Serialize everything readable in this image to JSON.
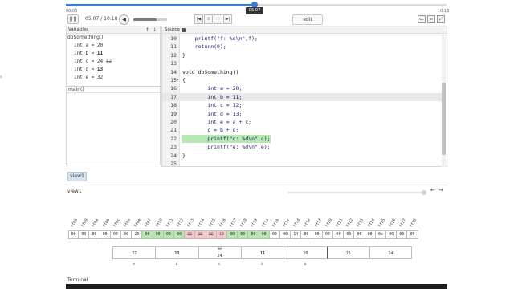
{
  "timeline": {
    "start": "00:00",
    "end": "10:18",
    "current": "05:07",
    "progress_fraction": 0.496
  },
  "toolbar": {
    "time_readout": "05:07 / 10:18",
    "volume_fraction": 0.7,
    "edit_label": "edit",
    "play_icon": "pause-icon"
  },
  "variables": {
    "title": "Variables",
    "frame": "doSomething()",
    "lines": [
      {
        "prefix": "int a = ",
        "value": "20",
        "old": ""
      },
      {
        "prefix": "int b = ",
        "value": "11",
        "old": ""
      },
      {
        "prefix": "int c = ",
        "value": "24",
        "old": "12"
      },
      {
        "prefix": "int d = ",
        "value": "13",
        "old": ""
      },
      {
        "prefix": "int e = ",
        "value": "32",
        "old": ""
      }
    ],
    "caller": "main()"
  },
  "source": {
    "title": "Source",
    "lines": [
      {
        "n": "10",
        "text": "    printf(\"f: %d\\n\",f);",
        "fold": ""
      },
      {
        "n": "11",
        "text": "    return(0);",
        "fold": ""
      },
      {
        "n": "12",
        "text": "}",
        "fold": ""
      },
      {
        "n": "13",
        "text": "",
        "fold": ""
      },
      {
        "n": "14",
        "text": "void doSomething()",
        "fold": ""
      },
      {
        "n": "15",
        "text": "{",
        "fold": "▾"
      },
      {
        "n": "16",
        "text": "        int a = 20;",
        "fold": ""
      },
      {
        "n": "17",
        "text": "        int b = 11;",
        "fold": ""
      },
      {
        "n": "18",
        "text": "        int c = 12;",
        "fold": ""
      },
      {
        "n": "19",
        "text": "        int d = 13;",
        "fold": ""
      },
      {
        "n": "20",
        "text": "        int e = a + c;",
        "fold": ""
      },
      {
        "n": "21",
        "text": "        c = b + d;",
        "fold": ""
      },
      {
        "n": "22",
        "text": "        printf(\"c: %d\\n\",c);",
        "fold": ""
      },
      {
        "n": "23",
        "text": "        printf(\"e: %d\\n\",e);",
        "fold": ""
      },
      {
        "n": "24",
        "text": "}",
        "fold": ""
      },
      {
        "n": "25",
        "text": "",
        "fold": ""
      }
    ],
    "current_line": "17",
    "highlight_line": "22"
  },
  "view1": {
    "tab_label": "view1",
    "pane_label": "view1",
    "addresses": [
      "ff08",
      "ff09",
      "ff0a",
      "ff0b",
      "ff0c",
      "ff0d",
      "ff0e",
      "ff0f",
      "ff10",
      "ff11",
      "ff12",
      "ff13",
      "ff14",
      "ff15",
      "ff16",
      "ff17",
      "ff18",
      "ff19",
      "ff1a",
      "ff1b",
      "ff1c",
      "ff1d",
      "ff1e",
      "ff1f",
      "ff20",
      "ff21",
      "ff22",
      "ff23",
      "ff24",
      "ff25",
      "ff26",
      "ff27",
      "ff28"
    ],
    "cells": [
      {
        "v": "00",
        "c": ""
      },
      {
        "v": "00",
        "c": ""
      },
      {
        "v": "00",
        "c": ""
      },
      {
        "v": "00",
        "c": ""
      },
      {
        "v": "00",
        "c": ""
      },
      {
        "v": "00",
        "c": ""
      },
      {
        "v": "20",
        "c": ""
      },
      {
        "v": "00",
        "c": "green"
      },
      {
        "v": "00",
        "c": "green"
      },
      {
        "v": "00",
        "c": "green"
      },
      {
        "v": "00",
        "c": "green"
      },
      {
        "v": "00",
        "c": "pink"
      },
      {
        "v": "00",
        "c": "pink"
      },
      {
        "v": "00",
        "c": "pink"
      },
      {
        "v": "18",
        "c": "pink"
      },
      {
        "v": "00",
        "c": "green"
      },
      {
        "v": "00",
        "c": "green"
      },
      {
        "v": "00",
        "c": "green"
      },
      {
        "v": "00",
        "c": "green"
      },
      {
        "v": "00",
        "c": ""
      },
      {
        "v": "00",
        "c": ""
      },
      {
        "v": "14",
        "c": ""
      },
      {
        "v": "00",
        "c": ""
      },
      {
        "v": "00",
        "c": ""
      },
      {
        "v": "00",
        "c": ""
      },
      {
        "v": "0f",
        "c": ""
      },
      {
        "v": "00",
        "c": ""
      },
      {
        "v": "00",
        "c": ""
      },
      {
        "v": "00",
        "c": ""
      },
      {
        "v": "0e",
        "c": ""
      },
      {
        "v": "00",
        "c": ""
      },
      {
        "v": "00",
        "c": ""
      },
      {
        "v": "00",
        "c": ""
      }
    ],
    "ints": [
      {
        "val": "32",
        "old": "",
        "name": "e",
        "bold": false
      },
      {
        "val": "13",
        "old": "",
        "name": "d",
        "bold": false
      },
      {
        "val": "24",
        "old": "12",
        "name": "c",
        "bold": false
      },
      {
        "val": "11",
        "old": "",
        "name": "b",
        "bold": false
      },
      {
        "val": "20",
        "old": "",
        "name": "a",
        "bold": false
      },
      {
        "val": "15",
        "old": "",
        "name": "",
        "bold": true
      },
      {
        "val": "14",
        "old": "",
        "name": "",
        "bold": false
      }
    ]
  },
  "terminal": {
    "label": "Terminal"
  }
}
